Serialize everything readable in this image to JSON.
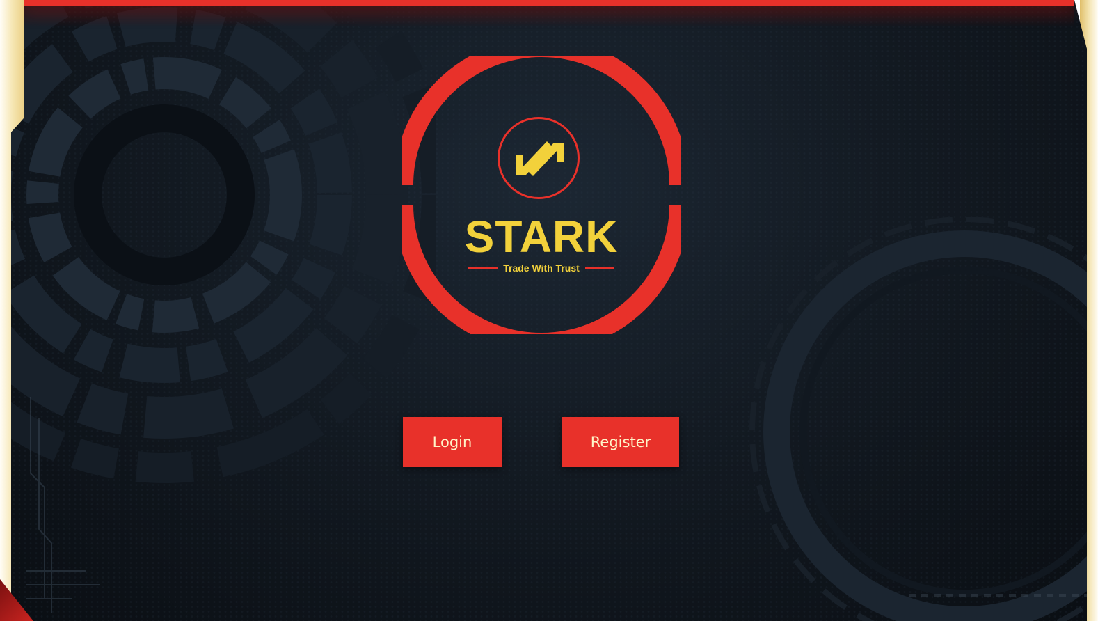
{
  "brand": {
    "name": "STARK",
    "tagline": "Trade With Trust",
    "logo_icon": "trade-arrows-icon"
  },
  "actions": {
    "login_label": "Login",
    "register_label": "Register"
  },
  "colors": {
    "accent_red": "#e8312a",
    "brand_yellow": "#f2d13b",
    "background_dark": "#131a22",
    "button_text": "#fff4c8"
  }
}
